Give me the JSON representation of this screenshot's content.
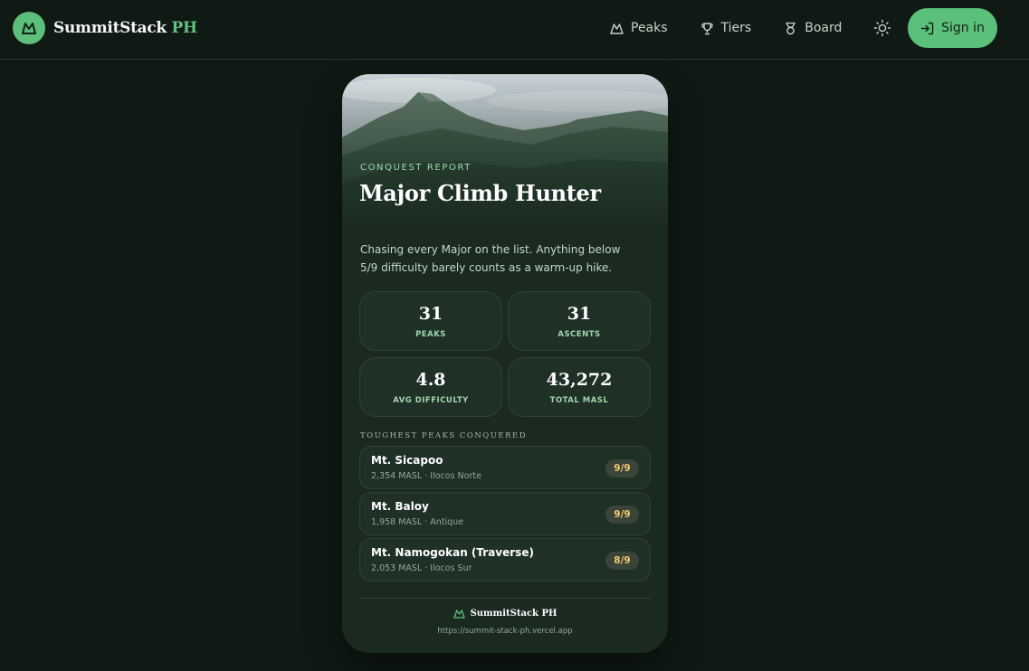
{
  "header": {
    "brand_name": "SummitStack",
    "brand_suffix": "PH",
    "nav": [
      {
        "label": "Peaks",
        "icon": "mountain-icon"
      },
      {
        "label": "Tiers",
        "icon": "trophy-icon"
      },
      {
        "label": "Board",
        "icon": "medal-icon"
      }
    ],
    "theme_icon": "sun-icon",
    "signin_label": "Sign in",
    "accent_color": "#5cbf7a"
  },
  "card": {
    "label": "CONQUEST REPORT",
    "title": "Major Climb Hunter",
    "description": "Chasing every Major on the list. Anything below 5/9 difficulty barely counts as a warm-up hike.",
    "stats": [
      {
        "value": "31",
        "label": "PEAKS"
      },
      {
        "value": "31",
        "label": "ASCENTS"
      },
      {
        "value": "4.8",
        "label": "AVG DIFFICULTY"
      },
      {
        "value": "43,272",
        "label": "TOTAL MASL"
      }
    ],
    "section_title": "TOUGHEST PEAKS CONQUERED",
    "peaks": [
      {
        "name": "Mt. Sicapoo",
        "meta": "2,354 MASL · Ilocos Norte",
        "difficulty": "9/9"
      },
      {
        "name": "Mt. Baloy",
        "meta": "1,958 MASL · Antique",
        "difficulty": "9/9"
      },
      {
        "name": "Mt. Namogokan (Traverse)",
        "meta": "2,053 MASL · Ilocos Sur",
        "difficulty": "8/9"
      }
    ],
    "footer_brand": "SummitStack PH",
    "footer_url": "https://summit-stack-ph.vercel.app"
  }
}
